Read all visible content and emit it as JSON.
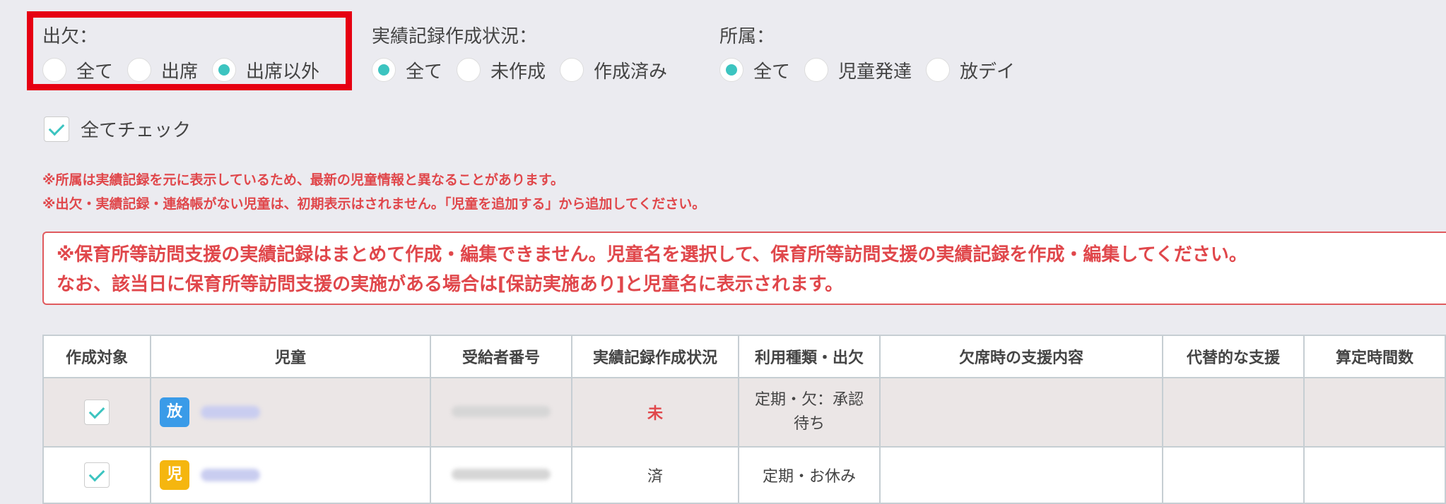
{
  "filters": {
    "attendance": {
      "label": "出欠：",
      "options": [
        "全て",
        "出席",
        "出席以外"
      ],
      "selected": "出席以外"
    },
    "record_status": {
      "label": "実績記録作成状況：",
      "options": [
        "全て",
        "未作成",
        "作成済み"
      ],
      "selected": "全て"
    },
    "affiliation": {
      "label": "所属：",
      "options": [
        "全て",
        "児童発達",
        "放デイ"
      ],
      "selected": "全て"
    }
  },
  "check_all_label": "全てチェック",
  "notes": [
    "※所属は実績記録を元に表示しているため、最新の児童情報と異なることがあります。",
    "※出欠・実績記録・連絡帳がない児童は、初期表示はされません。「児童を追加する」から追加してください。"
  ],
  "alert_lines": [
    "※保育所等訪問支援の実績記録はまとめて作成・編集できません。児童名を選択して、保育所等訪問支援の実績記録を作成・編集してください。",
    "なお、該当日に保育所等訪問支援の実施がある場合は[保訪実施あり]と児童名に表示されます。"
  ],
  "table": {
    "headers": [
      "作成対象",
      "児童",
      "受給者番号",
      "実績記録作成状況",
      "利用種類・出欠",
      "欠席時の支援内容",
      "代替的な支援",
      "算定時間数"
    ],
    "rows": [
      {
        "checked": true,
        "badge": "放",
        "badge_color": "#3a9be8",
        "status": "未",
        "usage": "定期・欠：承認待ち"
      },
      {
        "checked": true,
        "badge": "児",
        "badge_color": "#f5b60f",
        "status": "済",
        "usage": "定期・お休み"
      }
    ]
  },
  "colors": {
    "accent": "#3cc4c0",
    "highlight": "#e60012",
    "warning": "#e0474b"
  }
}
